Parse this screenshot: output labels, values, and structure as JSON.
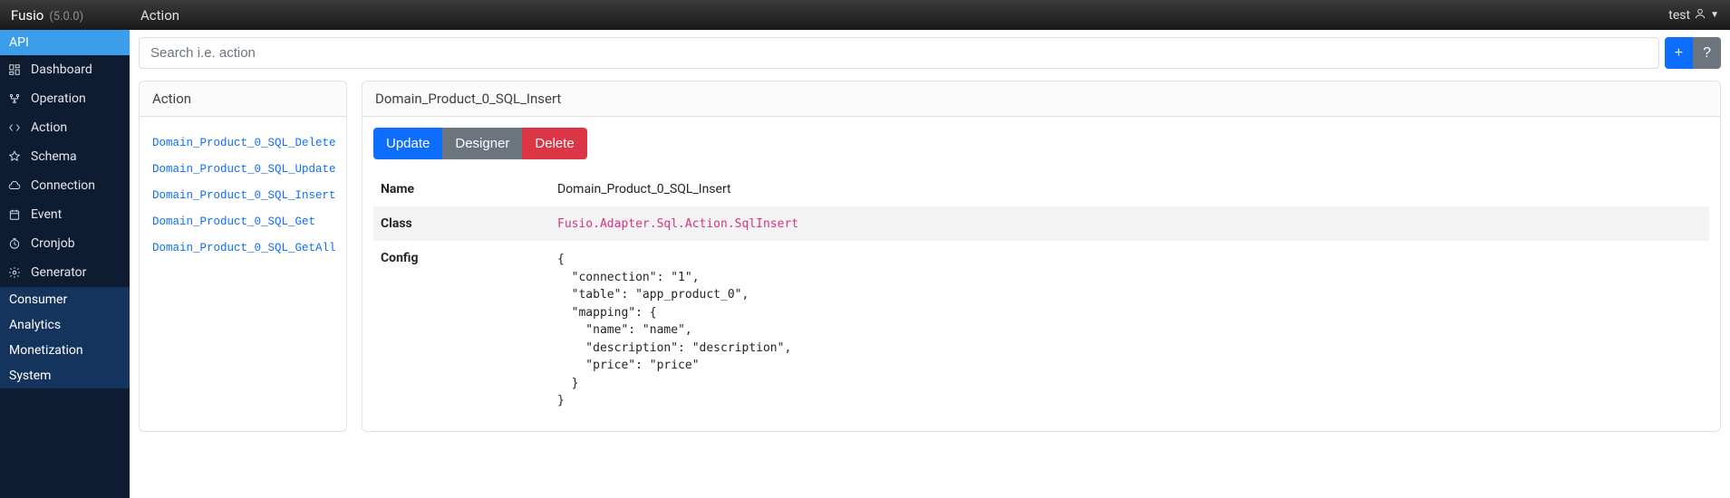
{
  "header": {
    "brand_name": "Fusio",
    "brand_version": "(5.0.0)",
    "page_title": "Action",
    "user_name": "test"
  },
  "sidebar": {
    "sections": [
      {
        "label": "API",
        "style": "active"
      },
      {
        "label": "Consumer",
        "style": "dark"
      },
      {
        "label": "Analytics",
        "style": "dark"
      },
      {
        "label": "Monetization",
        "style": "dark"
      },
      {
        "label": "System",
        "style": "dark"
      }
    ],
    "api_items": [
      {
        "icon": "dashboard-icon",
        "label": "Dashboard"
      },
      {
        "icon": "operation-icon",
        "label": "Operation"
      },
      {
        "icon": "action-icon",
        "label": "Action"
      },
      {
        "icon": "schema-icon",
        "label": "Schema"
      },
      {
        "icon": "connection-icon",
        "label": "Connection"
      },
      {
        "icon": "event-icon",
        "label": "Event"
      },
      {
        "icon": "cronjob-icon",
        "label": "Cronjob"
      },
      {
        "icon": "generator-icon",
        "label": "Generator"
      }
    ]
  },
  "search": {
    "placeholder": "Search i.e. action",
    "add_label": "+",
    "help_label": "?"
  },
  "action_list": {
    "title": "Action",
    "items": [
      "Domain_Product_0_SQL_Delete",
      "Domain_Product_0_SQL_Update",
      "Domain_Product_0_SQL_Insert",
      "Domain_Product_0_SQL_Get",
      "Domain_Product_0_SQL_GetAll"
    ]
  },
  "detail": {
    "title": "Domain_Product_0_SQL_Insert",
    "buttons": {
      "update": "Update",
      "designer": "Designer",
      "delete": "Delete"
    },
    "rows": {
      "name_label": "Name",
      "name_value": "Domain_Product_0_SQL_Insert",
      "class_label": "Class",
      "class_value": "Fusio.Adapter.Sql.Action.SqlInsert",
      "config_label": "Config",
      "config_value": "{\n  \"connection\": \"1\",\n  \"table\": \"app_product_0\",\n  \"mapping\": {\n    \"name\": \"name\",\n    \"description\": \"description\",\n    \"price\": \"price\"\n  }\n}"
    }
  }
}
